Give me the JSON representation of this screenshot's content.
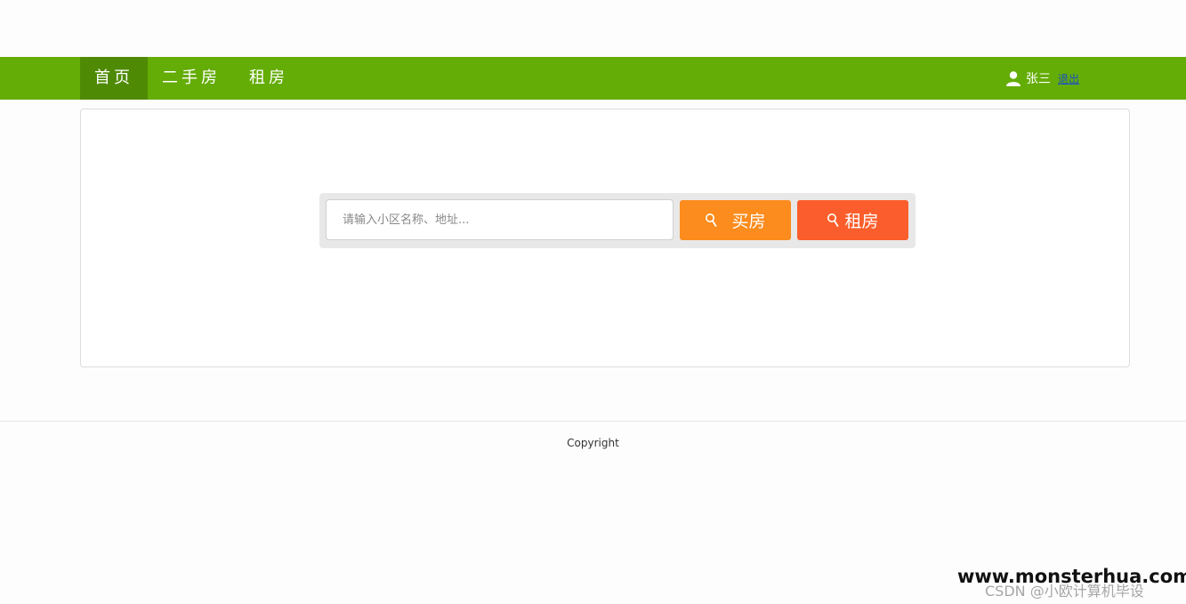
{
  "nav": {
    "items": [
      {
        "label": "首页",
        "active": true
      },
      {
        "label": "二手房",
        "active": false
      },
      {
        "label": "租房",
        "active": false
      }
    ],
    "user_name": "张三",
    "logout_label": "退出"
  },
  "search": {
    "placeholder": "请输入小区名称、地址...",
    "value": "",
    "buy_label": "买房",
    "rent_label": "租房"
  },
  "footer": {
    "copyright": "Copyright"
  },
  "watermark": {
    "site": "www.monsterhua.com",
    "csdn": "CSDN @小欧计算机毕设"
  },
  "colors": {
    "nav_bg": "#64ac06",
    "nav_active_bg": "#4f8a04",
    "buy_button": "#fb8c1d",
    "rent_button": "#fb5e2c"
  },
  "icons": {
    "user": "user-icon",
    "search": "search-icon"
  }
}
